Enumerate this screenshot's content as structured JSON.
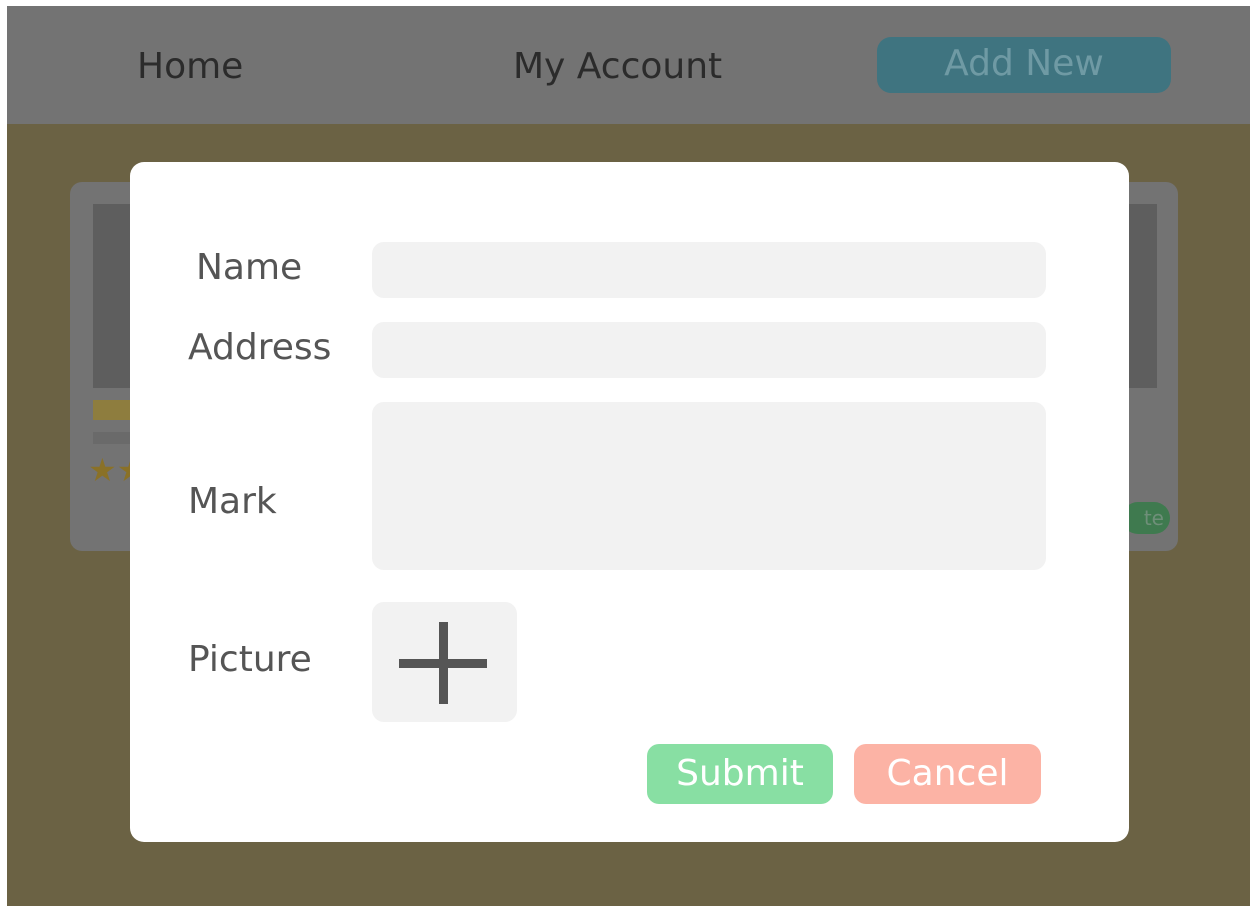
{
  "nav": {
    "home_label": "Home",
    "account_label": "My Account",
    "add_new_label": "Add New"
  },
  "background_card": {
    "stars": "★★",
    "badge_label": "te"
  },
  "form": {
    "name_label": "Name",
    "address_label": "Address",
    "mark_label": "Mark",
    "picture_label": "Picture",
    "name_value": "",
    "address_value": "",
    "mark_value": "",
    "picture_icon": "plus-icon",
    "submit_label": "Submit",
    "cancel_label": "Cancel"
  },
  "colors": {
    "overlay_background": "#6b6244",
    "navbar_dimmed": "#737373",
    "add_new_dimmed": "#3f7480",
    "field_background": "#f2f2f2",
    "submit": "#88dfa3",
    "cancel": "#fcb3a5",
    "label_text": "#555555"
  }
}
